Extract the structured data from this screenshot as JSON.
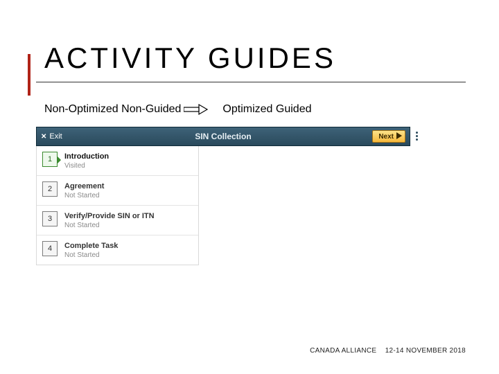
{
  "title": "ACTIVITY GUIDES",
  "labels": {
    "left": "Non-Optimized Non-Guided",
    "right": "Optimized Guided"
  },
  "topbar": {
    "exit_label": "Exit",
    "title": "SIN Collection",
    "next_label": "Next"
  },
  "steps": [
    {
      "num": "1",
      "title": "Introduction",
      "status": "Visited",
      "active": true
    },
    {
      "num": "2",
      "title": "Agreement",
      "status": "Not Started",
      "active": false
    },
    {
      "num": "3",
      "title": "Verify/Provide SIN or ITN",
      "status": "Not Started",
      "active": false
    },
    {
      "num": "4",
      "title": "Complete Task",
      "status": "Not Started",
      "active": false
    }
  ],
  "footer": {
    "org": "CANADA ALLIANCE",
    "dates": "12-14 NOVEMBER 2018"
  }
}
